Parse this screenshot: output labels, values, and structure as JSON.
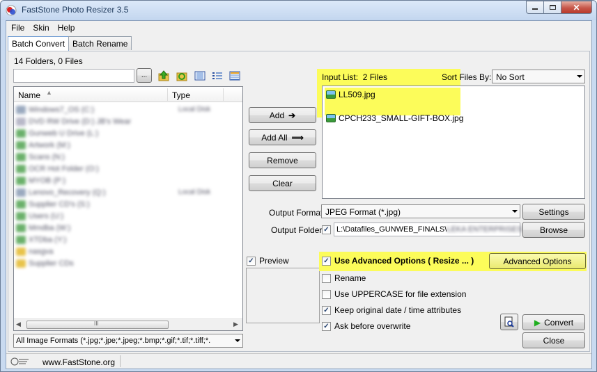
{
  "window": {
    "title": "FastStone Photo Resizer 3.5"
  },
  "menu": [
    "File",
    "Skin",
    "Help"
  ],
  "tabs": [
    "Batch Convert",
    "Batch Rename"
  ],
  "left": {
    "folder_count": "14 Folders, 0 Files",
    "browse_btn": "...",
    "columns": [
      "Name",
      "Type"
    ],
    "rows": [
      {
        "name": "Windows7_OS (C:)",
        "type": "Local Disk",
        "icon": "drive-icon"
      },
      {
        "name": "DVD RW Drive (D:) JB's Wear",
        "type": "",
        "icon": "dvd-drive-icon"
      },
      {
        "name": "Gunweb U Drive (L:)",
        "type": "",
        "icon": "network-drive-icon"
      },
      {
        "name": "Artwork (M:)",
        "type": "",
        "icon": "network-drive-icon"
      },
      {
        "name": "Scans (N:)",
        "type": "",
        "icon": "network-drive-icon"
      },
      {
        "name": "OCR Hot Folder (O:)",
        "type": "",
        "icon": "network-drive-icon"
      },
      {
        "name": "MYOB (P:)",
        "type": "",
        "icon": "network-drive-icon"
      },
      {
        "name": "Lenovo_Recovery (Q:)",
        "type": "Local Disk",
        "icon": "drive-icon"
      },
      {
        "name": "Supplier CD's (S:)",
        "type": "",
        "icon": "network-drive-icon"
      },
      {
        "name": "Users (U:)",
        "type": "",
        "icon": "network-drive-icon"
      },
      {
        "name": "Mmdba (W:)",
        "type": "",
        "icon": "network-drive-icon"
      },
      {
        "name": "XTDba (Y:)",
        "type": "",
        "icon": "network-drive-icon"
      },
      {
        "name": "nasgva",
        "type": "",
        "icon": "folder-icon"
      },
      {
        "name": "Supplier CDs",
        "type": "",
        "icon": "folder-icon"
      }
    ],
    "format_filter": "All Image Formats (*.jpg;*.jpe;*.jpeg;*.bmp;*.gif;*.tif;*.tiff;*."
  },
  "middle": {
    "add": "Add",
    "add_all": "Add All",
    "remove": "Remove",
    "clear": "Clear",
    "preview": "Preview"
  },
  "right": {
    "input_list_label": "Input List:",
    "input_count": "2 Files",
    "sort_label": "Sort Files By:",
    "sort_value": "No Sort",
    "files": [
      "LL509.jpg",
      "CPCH233_SMALL-GIFT-BOX.jpg"
    ],
    "output_format_label": "Output Format:",
    "output_format_value": "JPEG Format (*.jpg)",
    "settings": "Settings",
    "output_folder_label": "Output Folder:",
    "output_folder_value": "L:\\Datafiles_GUNWEB_FINALS\\",
    "output_folder_blur": "LEKA ENTERPRISES BS_",
    "browse": "Browse",
    "use_advanced": "Use Advanced Options ( Resize ... )",
    "advanced_btn": "Advanced Options",
    "opts": [
      {
        "label": "Rename",
        "checked": false
      },
      {
        "label": "Use UPPERCASE for file extension",
        "checked": false
      },
      {
        "label": "Keep original date / time attributes",
        "checked": true
      },
      {
        "label": "Ask before overwrite",
        "checked": true
      }
    ],
    "convert": "Convert",
    "close": "Close"
  },
  "status": {
    "url": "www.FastStone.org"
  },
  "colors": {
    "highlight": "#fcfc5a",
    "convert_green": "#1fae1f"
  }
}
